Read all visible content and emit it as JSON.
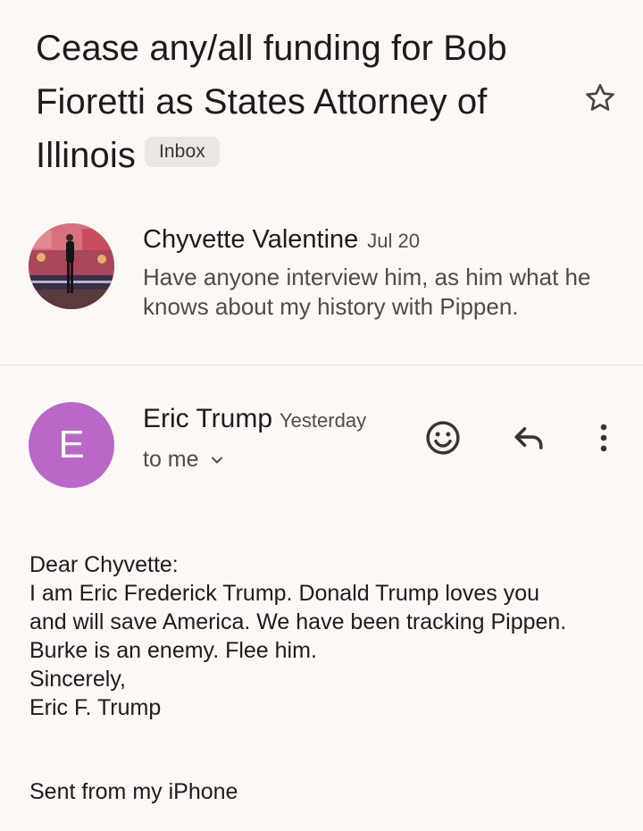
{
  "thread": {
    "subject": "Cease any/all funding for Bob Fioretti as States Attorney of Illinois",
    "label": "Inbox",
    "star_icon": "star-outline-icon"
  },
  "collapsed_message": {
    "sender": "Chyvette Valentine",
    "date": "Jul 20",
    "snippet": "Have anyone interview him, as him what he knows about my history with Pippen."
  },
  "expanded_message": {
    "avatar_letter": "E",
    "avatar_color": "#ba68c8",
    "sender": "Eric Trump",
    "time": "Yesterday",
    "recipients": "to me",
    "actions": {
      "emoji": "emoji-reaction-icon",
      "reply": "reply-icon",
      "more": "more-vertical-icon"
    },
    "body_lines": [
      "Dear Chyvette:",
      "I am Eric Frederick Trump. Donald Trump loves you",
      "and will save America. We have been tracking Pippen.",
      "Burke is an enemy. Flee him.",
      "Sincerely,",
      "Eric F. Trump"
    ],
    "signature": "Sent from my iPhone"
  }
}
